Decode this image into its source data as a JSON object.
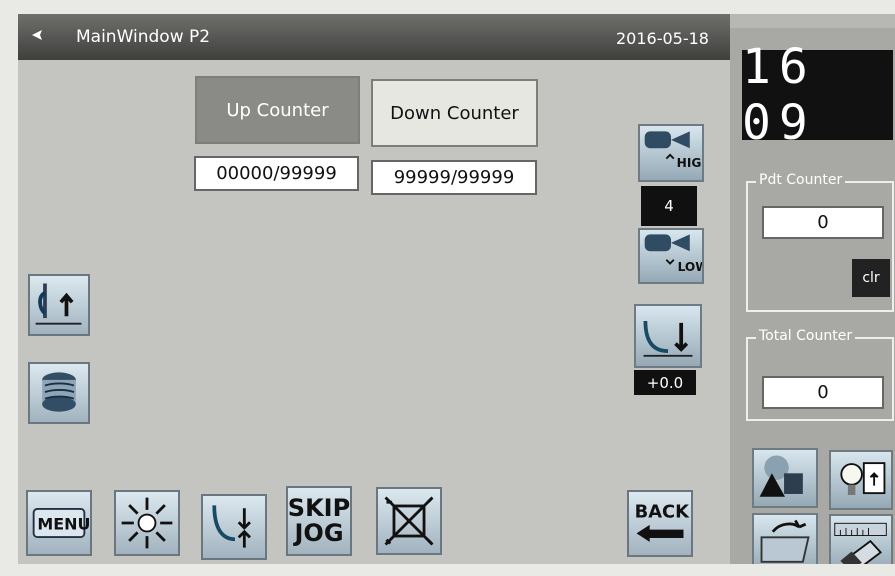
{
  "window": {
    "title": "MainWindow P2",
    "date": "2016-05-18"
  },
  "clock": {
    "time": "16 09"
  },
  "counters": {
    "up_label": "Up Counter",
    "down_label": "Down Counter",
    "up_value": "00000/99999",
    "down_value": "99999/99999"
  },
  "speed": {
    "high_label": "HIGH",
    "low_label": "LOW",
    "value": "4"
  },
  "offset": {
    "value": "+0.0"
  },
  "pdt_counter": {
    "label": "Pdt Counter",
    "value": "0",
    "clear_label": "clr"
  },
  "total_counter": {
    "label": "Total Counter",
    "value": "0"
  },
  "toolbar": {
    "menu_label": "MENU",
    "skip_label": "SKIP",
    "jog_label": "JOG",
    "back_label": "BACK"
  }
}
